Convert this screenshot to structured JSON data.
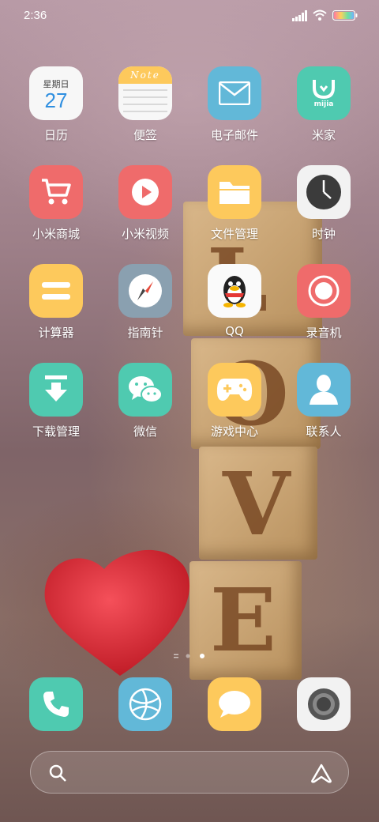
{
  "status_bar": {
    "time": "2:36"
  },
  "apps": [
    {
      "name": "calendar",
      "label": "日历",
      "day_name": "星期日",
      "day": "27"
    },
    {
      "name": "notes",
      "label": "便签",
      "banner": "Note"
    },
    {
      "name": "email",
      "label": "电子邮件"
    },
    {
      "name": "mijia",
      "label": "米家",
      "logo_text": "mijia"
    },
    {
      "name": "mi-store",
      "label": "小米商城"
    },
    {
      "name": "mi-video",
      "label": "小米视频"
    },
    {
      "name": "file-manager",
      "label": "文件管理"
    },
    {
      "name": "clock",
      "label": "时钟"
    },
    {
      "name": "calculator",
      "label": "计算器"
    },
    {
      "name": "compass",
      "label": "指南针"
    },
    {
      "name": "qq",
      "label": "QQ"
    },
    {
      "name": "recorder",
      "label": "录音机"
    },
    {
      "name": "downloads",
      "label": "下载管理"
    },
    {
      "name": "wechat",
      "label": "微信"
    },
    {
      "name": "game-center",
      "label": "游戏中心"
    },
    {
      "name": "contacts",
      "label": "联系人"
    }
  ],
  "dock": [
    "phone",
    "browser",
    "messages",
    "camera"
  ],
  "pager": {
    "pages": 2,
    "current": 2
  },
  "wallpaper": {
    "letters": [
      "L",
      "O",
      "V",
      "E"
    ]
  },
  "colors": {
    "accent_blue": "#62b8d8",
    "accent_red": "#ef6b6b",
    "accent_yellow": "#fdc95c",
    "accent_teal": "#4fcab0"
  }
}
